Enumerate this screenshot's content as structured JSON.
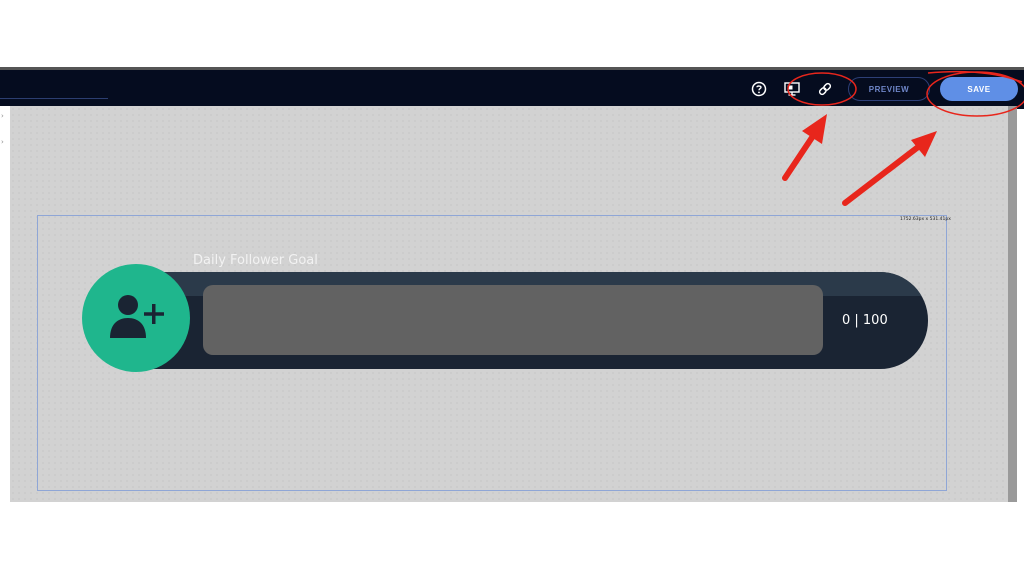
{
  "toolbar": {
    "icons": [
      "help-icon",
      "screen-preview-icon",
      "link-icon"
    ],
    "preview_label": "PREVIEW",
    "save_label": "SAVE"
  },
  "widget": {
    "dimensions": "1752.63px x 531.41px",
    "title": "Daily Follower Goal",
    "progress": {
      "current": 0,
      "goal": 100,
      "fraction": 0.0
    },
    "count_label": "0 | 100",
    "avatar_icon": "add-user-icon"
  },
  "annotations": {
    "color": "#e8261c",
    "arrows": 2,
    "circled": [
      "link-icon",
      "save-button"
    ]
  },
  "colors": {
    "topbar": "#050c1f",
    "save_button": "#5f8fe6",
    "avatar": "#1fb68d",
    "bar": "#1a2433",
    "track": "#626262"
  }
}
